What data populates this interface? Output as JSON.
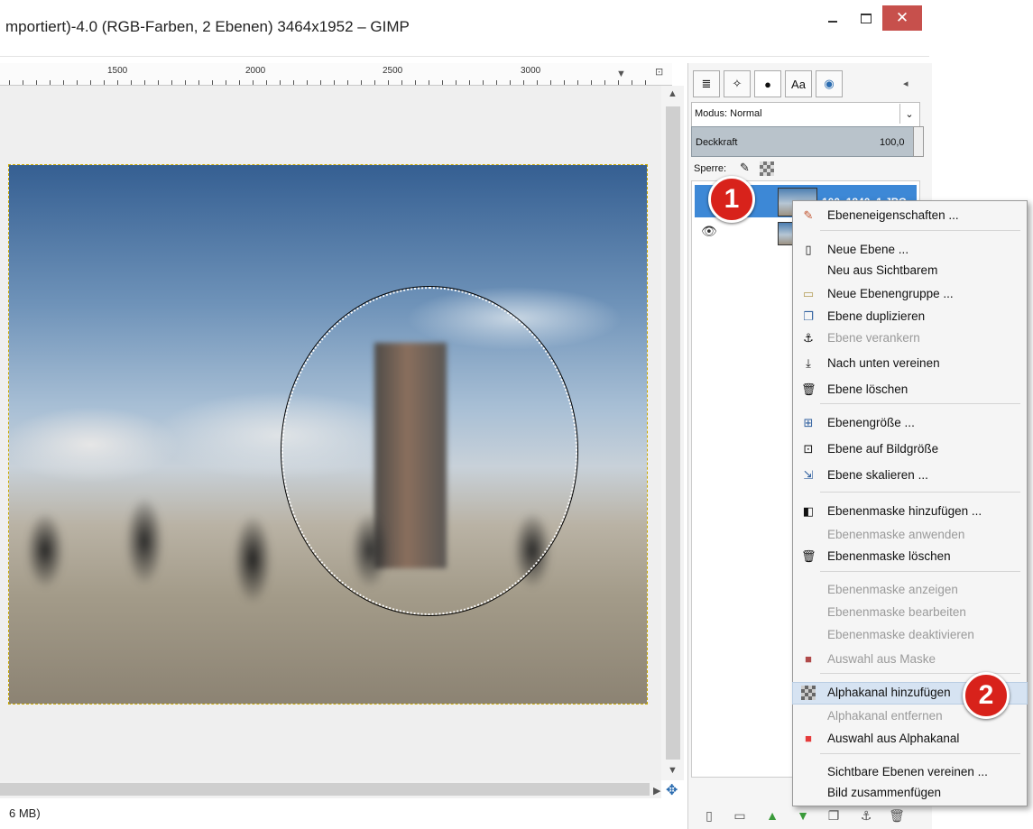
{
  "window": {
    "title": "mportiert)-4.0 (RGB-Farben, 2 Ebenen) 3464x1952 – GIMP",
    "close_label": "✕"
  },
  "ruler": {
    "labels": [
      "1500",
      "2000",
      "2500",
      "3000"
    ]
  },
  "status": {
    "text": "6 MB)"
  },
  "dock": {
    "mode_label": "Modus: Normal",
    "opacity_label": "Deckkraft",
    "opacity_value": "100,0",
    "lock_label": "Sperre:",
    "layer_name": "100_1840_1.JPG"
  },
  "markers": {
    "one": "1",
    "two": "2"
  },
  "context_menu": {
    "items": [
      {
        "label": "Ebeneneigenschaften ...",
        "icon": "pencil-icon"
      },
      {
        "label": "Neue Ebene ...",
        "icon": "page-icon"
      },
      {
        "label": "Neu aus Sichtbarem",
        "icon": ""
      },
      {
        "label": "Neue Ebenengruppe ...",
        "icon": "folder-icon"
      },
      {
        "label": "Ebene duplizieren",
        "icon": "duplicate-icon"
      },
      {
        "label": "Ebene verankern",
        "icon": "anchor-icon"
      },
      {
        "label": "Nach unten vereinen",
        "icon": "merge-down-icon"
      },
      {
        "label": "Ebene löschen",
        "icon": "trash-icon"
      },
      {
        "label": "Ebenengröße ...",
        "icon": "layer-size-icon"
      },
      {
        "label": "Ebene auf Bildgröße",
        "icon": "fit-image-icon"
      },
      {
        "label": "Ebene skalieren ...",
        "icon": "scale-icon"
      },
      {
        "label": "Ebenenmaske hinzufügen ...",
        "icon": "add-mask-icon"
      },
      {
        "label": "Ebenenmaske anwenden",
        "icon": ""
      },
      {
        "label": "Ebenenmaske löschen",
        "icon": "trash-icon"
      },
      {
        "label": "Ebenenmaske anzeigen",
        "icon": ""
      },
      {
        "label": "Ebenenmaske bearbeiten",
        "icon": ""
      },
      {
        "label": "Ebenenmaske deaktivieren",
        "icon": ""
      },
      {
        "label": "Auswahl aus Maske",
        "icon": "mask-selection-icon"
      },
      {
        "label": "Alphakanal hinzufügen",
        "icon": "checker-icon"
      },
      {
        "label": "Alphakanal entfernen",
        "icon": ""
      },
      {
        "label": "Auswahl aus Alphakanal",
        "icon": "red-square-icon"
      },
      {
        "label": "Sichtbare Ebenen vereinen ...",
        "icon": ""
      },
      {
        "label": "Bild zusammenfügen",
        "icon": ""
      }
    ]
  },
  "colors": {
    "accent_selection": "#3d88d6",
    "marker_red": "#d8221b",
    "highlight": "#d6e3f2"
  }
}
